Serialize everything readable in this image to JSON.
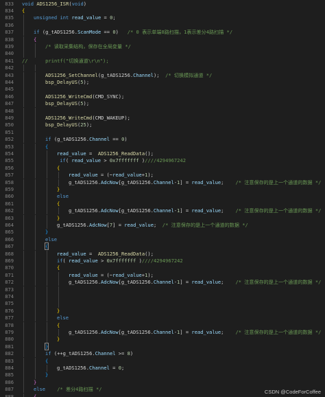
{
  "editor": {
    "theme": "dark",
    "colors": {
      "background": "#1e1e1e",
      "line_number": "#858585",
      "keyword": "#569cd6",
      "function": "#dcdcaa",
      "variable": "#9cdcfe",
      "comment": "#6a9955",
      "number": "#b5cea8",
      "string": "#ce9178"
    },
    "lines": [
      {
        "n": "833",
        "g": 0,
        "t": [
          [
            "kw",
            "void"
          ],
          [
            "pn",
            " "
          ],
          [
            "fn",
            "ADS1256_ISR"
          ],
          [
            "pn",
            "("
          ],
          [
            "kw",
            "void"
          ],
          [
            "pn",
            ")"
          ]
        ]
      },
      {
        "n": "834",
        "g": 0,
        "t": [
          [
            "br",
            "{"
          ]
        ]
      },
      {
        "n": "835",
        "g": 1,
        "t": [
          [
            "kw",
            "unsigned"
          ],
          [
            "pn",
            " "
          ],
          [
            "kw",
            "int"
          ],
          [
            "pn",
            " "
          ],
          [
            "id",
            "read_value"
          ],
          [
            "pn",
            " = "
          ],
          [
            "nm",
            "0"
          ],
          [
            "pn",
            ";"
          ]
        ]
      },
      {
        "n": "836",
        "g": 1,
        "t": []
      },
      {
        "n": "837",
        "g": 1,
        "t": [
          [
            "kw",
            "if"
          ],
          [
            "pn",
            " (g_tADS1256."
          ],
          [
            "id",
            "ScanMode"
          ],
          [
            "pn",
            " == "
          ],
          [
            "nm",
            "0"
          ],
          [
            "pn",
            ")   "
          ],
          [
            "cm",
            "/* 0 表示单端8路扫描，1表示差分4路扫描 */"
          ]
        ]
      },
      {
        "n": "838",
        "g": 1,
        "t": [
          [
            "br2",
            "{"
          ]
        ]
      },
      {
        "n": "839",
        "g": 2,
        "t": [
          [
            "cm",
            "/* 读取采集结构，保存在全局变量 */"
          ]
        ]
      },
      {
        "n": "840",
        "g": 2,
        "t": []
      },
      {
        "n": "841",
        "g": 0,
        "t": [
          [
            "cm",
            "//      printf(\"切换通道\\r\\n\");"
          ]
        ]
      },
      {
        "n": "842",
        "g": 2,
        "t": []
      },
      {
        "n": "843",
        "g": 2,
        "t": [
          [
            "fn",
            "ADS1256_SetChannel"
          ],
          [
            "pn",
            "(g_tADS1256."
          ],
          [
            "id",
            "Channel"
          ],
          [
            "pn",
            ");  "
          ],
          [
            "cm",
            "/* 切换模拟通道 */"
          ]
        ]
      },
      {
        "n": "844",
        "g": 2,
        "t": [
          [
            "fn",
            "bsp_DelayUS"
          ],
          [
            "pn",
            "("
          ],
          [
            "nm",
            "5"
          ],
          [
            "pn",
            ");"
          ]
        ]
      },
      {
        "n": "845",
        "g": 2,
        "t": []
      },
      {
        "n": "846",
        "g": 2,
        "t": [
          [
            "fn",
            "ADS1256_WriteCmd"
          ],
          [
            "pn",
            "(CMD_SYNC);"
          ]
        ]
      },
      {
        "n": "847",
        "g": 2,
        "t": [
          [
            "fn",
            "bsp_DelayUS"
          ],
          [
            "pn",
            "("
          ],
          [
            "nm",
            "5"
          ],
          [
            "pn",
            ");"
          ]
        ]
      },
      {
        "n": "848",
        "g": 2,
        "t": []
      },
      {
        "n": "849",
        "g": 2,
        "t": [
          [
            "fn",
            "ADS1256_WriteCmd"
          ],
          [
            "pn",
            "(CMD_WAKEUP);"
          ]
        ]
      },
      {
        "n": "850",
        "g": 2,
        "t": [
          [
            "fn",
            "bsp_DelayUS"
          ],
          [
            "pn",
            "("
          ],
          [
            "nm",
            "25"
          ],
          [
            "pn",
            ");"
          ]
        ]
      },
      {
        "n": "851",
        "g": 2,
        "t": []
      },
      {
        "n": "852",
        "g": 2,
        "t": [
          [
            "kw",
            "if"
          ],
          [
            "pn",
            " (g_tADS1256."
          ],
          [
            "id",
            "Channel"
          ],
          [
            "pn",
            " == "
          ],
          [
            "nm",
            "0"
          ],
          [
            "pn",
            ")"
          ]
        ]
      },
      {
        "n": "853",
        "g": 2,
        "t": [
          [
            "br3",
            "{"
          ]
        ]
      },
      {
        "n": "854",
        "g": 3,
        "t": [
          [
            "id",
            "read_value"
          ],
          [
            "pn",
            " =  "
          ],
          [
            "fn",
            "ADS1256_ReadData"
          ],
          [
            "pn",
            "();"
          ]
        ]
      },
      {
        "n": "855",
        "g": 3,
        "t": [
          [
            "pn",
            " "
          ],
          [
            "kw",
            "if"
          ],
          [
            "pn",
            "( "
          ],
          [
            "id",
            "read_value"
          ],
          [
            "pn",
            " > "
          ],
          [
            "nm",
            "0x7fffffff"
          ],
          [
            "pn",
            " )"
          ],
          [
            "cm",
            "////4294967242"
          ]
        ]
      },
      {
        "n": "856",
        "g": 3,
        "t": [
          [
            "br",
            "{"
          ]
        ]
      },
      {
        "n": "857",
        "g": 4,
        "t": [
          [
            "id",
            "read_value"
          ],
          [
            "pn",
            " = (~"
          ],
          [
            "id",
            "read_value"
          ],
          [
            "pn",
            "+"
          ],
          [
            "nm",
            "1"
          ],
          [
            "pn",
            ");"
          ]
        ]
      },
      {
        "n": "858",
        "g": 4,
        "t": [
          [
            "pn",
            "g_tADS1256."
          ],
          [
            "id",
            "AdcNow"
          ],
          [
            "pn",
            "[g_tADS1256."
          ],
          [
            "id",
            "Channel"
          ],
          [
            "pn",
            "-"
          ],
          [
            "nm",
            "1"
          ],
          [
            "pn",
            "] = "
          ],
          [
            "id",
            "read_value"
          ],
          [
            "pn",
            ";    "
          ],
          [
            "cm",
            "/* 注意保存的是上一个通道的数据 */"
          ]
        ]
      },
      {
        "n": "859",
        "g": 3,
        "t": [
          [
            "br",
            "}"
          ]
        ]
      },
      {
        "n": "860",
        "g": 3,
        "t": [
          [
            "kw",
            "else"
          ]
        ]
      },
      {
        "n": "861",
        "g": 3,
        "t": [
          [
            "br",
            "{"
          ]
        ]
      },
      {
        "n": "862",
        "g": 4,
        "t": [
          [
            "pn",
            "g_tADS1256."
          ],
          [
            "id",
            "AdcNow"
          ],
          [
            "pn",
            "[g_tADS1256."
          ],
          [
            "id",
            "Channel"
          ],
          [
            "pn",
            "-"
          ],
          [
            "nm",
            "1"
          ],
          [
            "pn",
            "] = "
          ],
          [
            "id",
            "read_value"
          ],
          [
            "pn",
            ";    "
          ],
          [
            "cm",
            "/* 注意保存的是上一个通道的数据 */"
          ]
        ]
      },
      {
        "n": "863",
        "g": 3,
        "t": [
          [
            "br",
            "}"
          ]
        ]
      },
      {
        "n": "864",
        "g": 3,
        "t": [
          [
            "pn",
            "g_tADS1256."
          ],
          [
            "id",
            "AdcNow"
          ],
          [
            "pn",
            "["
          ],
          [
            "nm",
            "7"
          ],
          [
            "pn",
            "] = "
          ],
          [
            "id",
            "read_value"
          ],
          [
            "pn",
            ";  "
          ],
          [
            "cm",
            "/* 注意保存的是上一个通道的数据 */"
          ]
        ]
      },
      {
        "n": "865",
        "g": 2,
        "t": [
          [
            "br3",
            "}"
          ]
        ]
      },
      {
        "n": "866",
        "g": 2,
        "t": [
          [
            "kw",
            "else"
          ]
        ]
      },
      {
        "n": "867",
        "g": 2,
        "t": [
          [
            "br3",
            "{"
          ]
        ],
        "box": true
      },
      {
        "n": "868",
        "g": 3,
        "t": [
          [
            "id",
            "read_value"
          ],
          [
            "pn",
            " =  "
          ],
          [
            "fn",
            "ADS1256_ReadData"
          ],
          [
            "pn",
            "();"
          ]
        ]
      },
      {
        "n": "869",
        "g": 3,
        "t": [
          [
            "kw",
            "if"
          ],
          [
            "pn",
            "( "
          ],
          [
            "id",
            "read_value"
          ],
          [
            "pn",
            " > "
          ],
          [
            "nm",
            "0x7fffffff"
          ],
          [
            "pn",
            " )"
          ],
          [
            "cm",
            "////4294967242"
          ]
        ]
      },
      {
        "n": "870",
        "g": 3,
        "t": [
          [
            "br",
            "{"
          ]
        ]
      },
      {
        "n": "871",
        "g": 4,
        "t": [
          [
            "id",
            "read_value"
          ],
          [
            "pn",
            " = (~"
          ],
          [
            "id",
            "read_value"
          ],
          [
            "pn",
            "+"
          ],
          [
            "nm",
            "1"
          ],
          [
            "pn",
            ");"
          ]
        ]
      },
      {
        "n": "872",
        "g": 4,
        "t": [
          [
            "pn",
            "g_tADS1256."
          ],
          [
            "id",
            "AdcNow"
          ],
          [
            "pn",
            "[g_tADS1256."
          ],
          [
            "id",
            "Channel"
          ],
          [
            "pn",
            "-"
          ],
          [
            "nm",
            "1"
          ],
          [
            "pn",
            "] = "
          ],
          [
            "id",
            "read_value"
          ],
          [
            "pn",
            ";    "
          ],
          [
            "cm",
            "/* 注意保存的是上一个通道的数据 */"
          ]
        ]
      },
      {
        "n": "873",
        "g": 4,
        "t": []
      },
      {
        "n": "874",
        "g": 4,
        "t": []
      },
      {
        "n": "875",
        "g": 4,
        "t": []
      },
      {
        "n": "876",
        "g": 3,
        "t": [
          [
            "br",
            "}"
          ]
        ]
      },
      {
        "n": "877",
        "g": 3,
        "t": [
          [
            "kw",
            "else"
          ]
        ]
      },
      {
        "n": "878",
        "g": 3,
        "t": [
          [
            "br",
            "{"
          ]
        ]
      },
      {
        "n": "879",
        "g": 4,
        "t": [
          [
            "pn",
            "g_tADS1256."
          ],
          [
            "id",
            "AdcNow"
          ],
          [
            "pn",
            "[g_tADS1256."
          ],
          [
            "id",
            "Channel"
          ],
          [
            "pn",
            "-"
          ],
          [
            "nm",
            "1"
          ],
          [
            "pn",
            "] = "
          ],
          [
            "id",
            "read_value"
          ],
          [
            "pn",
            ";    "
          ],
          [
            "cm",
            "/* 注意保存的是上一个通道的数据 */"
          ]
        ]
      },
      {
        "n": "880",
        "g": 3,
        "t": [
          [
            "br",
            "}"
          ]
        ]
      },
      {
        "n": "881",
        "g": 2,
        "t": [
          [
            "br3",
            "}"
          ]
        ],
        "box": true
      },
      {
        "n": "882",
        "g": 2,
        "t": [
          [
            "kw",
            "if"
          ],
          [
            "pn",
            " (++g_tADS1256."
          ],
          [
            "id",
            "Channel"
          ],
          [
            "pn",
            " >= "
          ],
          [
            "nm",
            "8"
          ],
          [
            "pn",
            ")"
          ]
        ]
      },
      {
        "n": "883",
        "g": 2,
        "t": [
          [
            "br3",
            "{"
          ]
        ]
      },
      {
        "n": "884",
        "g": 3,
        "t": [
          [
            "pn",
            "g_tADS1256."
          ],
          [
            "id",
            "Channel"
          ],
          [
            "pn",
            " = "
          ],
          [
            "nm",
            "0"
          ],
          [
            "pn",
            ";"
          ]
        ]
      },
      {
        "n": "885",
        "g": 2,
        "t": [
          [
            "br3",
            "}"
          ]
        ]
      },
      {
        "n": "886",
        "g": 1,
        "t": [
          [
            "br2",
            "}"
          ]
        ]
      },
      {
        "n": "887",
        "g": 1,
        "t": [
          [
            "kw",
            "else"
          ],
          [
            "pn",
            "    "
          ],
          [
            "cm",
            "/* 差分4路扫描 */"
          ]
        ]
      },
      {
        "n": "888",
        "g": 1,
        "t": [
          [
            "br2",
            "{"
          ]
        ]
      }
    ]
  },
  "watermark": {
    "text": "CSDN @CodeForCoffee"
  }
}
